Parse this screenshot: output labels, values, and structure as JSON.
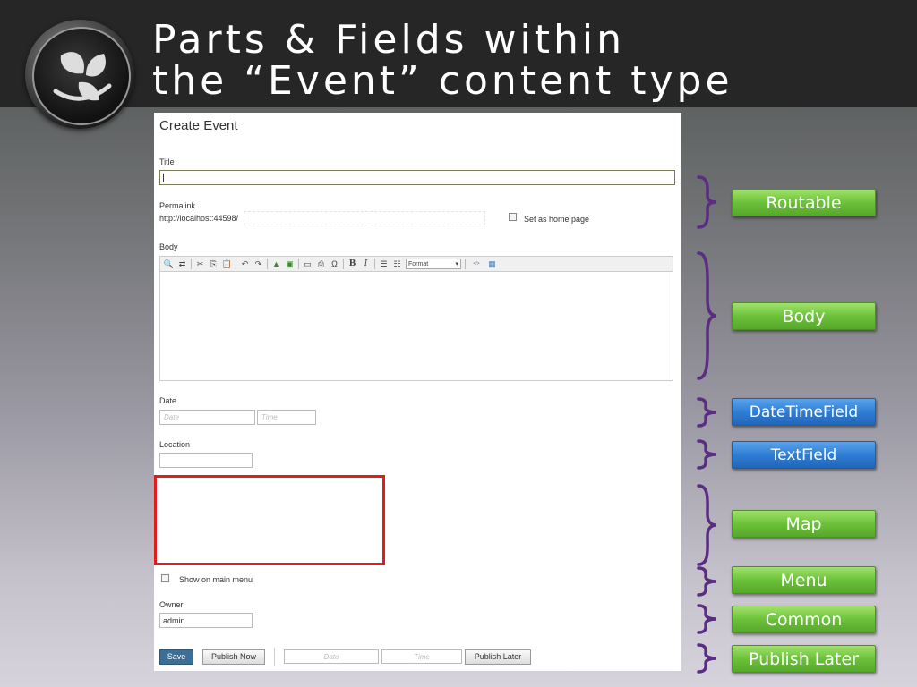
{
  "slide": {
    "title_line1": "Parts & Fields within",
    "title_line2": "the “Event” content type"
  },
  "form": {
    "heading": "Create Event",
    "title_label": "Title",
    "permalink_label": "Permalink",
    "permalink_prefix": "http://localhost:44598/",
    "home_page_label": "Set as home page",
    "body_label": "Body",
    "format_label": "Format",
    "date_label": "Date",
    "date_placeholder": "Date",
    "time_placeholder": "Time",
    "location_label": "Location",
    "show_menu_label": "Show on main menu",
    "owner_label": "Owner",
    "owner_value": "admin",
    "save_label": "Save",
    "publish_now_label": "Publish Now",
    "publish_date_placeholder": "Date",
    "publish_time_placeholder": "Time",
    "publish_later_label": "Publish Later"
  },
  "toolbar_icons": [
    "find-icon",
    "replace-icon",
    "cut-icon",
    "copy-icon",
    "paste-icon",
    "undo-icon",
    "redo-icon",
    "image-icon",
    "media-icon",
    "hr-icon",
    "print-icon",
    "special-char-icon",
    "bold-icon",
    "italic-icon",
    "numbered-list-icon",
    "bullet-list-icon",
    "html-icon",
    "fullscreen-icon"
  ],
  "tags": [
    {
      "label": "Routable",
      "kind": "part"
    },
    {
      "label": "Body",
      "kind": "part"
    },
    {
      "label": "DateTimeField",
      "kind": "field"
    },
    {
      "label": "TextField",
      "kind": "field"
    },
    {
      "label": "Map",
      "kind": "part"
    },
    {
      "label": "Menu",
      "kind": "part"
    },
    {
      "label": "Common",
      "kind": "part"
    },
    {
      "label": "Publish Later",
      "kind": "part"
    }
  ],
  "colors": {
    "part_green": "#6cc13a",
    "field_blue": "#2f7ed6",
    "brace_purple": "#5a2d82",
    "highlight_red": "#e21c1c",
    "header_bg": "#262626"
  }
}
